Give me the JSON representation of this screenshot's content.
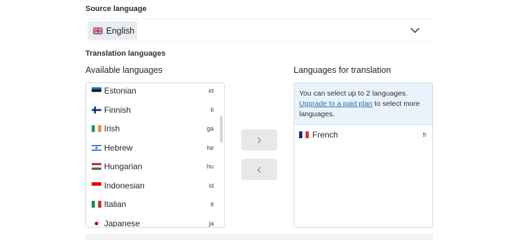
{
  "source": {
    "label": "Source language",
    "selected": "English",
    "selected_flag": "uk-flag-icon",
    "dropdown_icon": "chevron-down-icon"
  },
  "translation": {
    "label": "Translation languages",
    "available_heading": "Available languages",
    "target_heading": "Languages for translation",
    "available": [
      {
        "name": "Estonian",
        "code": "et",
        "flag": "estonia-flag-icon"
      },
      {
        "name": "Finnish",
        "code": "fi",
        "flag": "finland-flag-icon"
      },
      {
        "name": "Irish",
        "code": "ga",
        "flag": "ireland-flag-icon"
      },
      {
        "name": "Hebrew",
        "code": "he",
        "flag": "israel-flag-icon"
      },
      {
        "name": "Hungarian",
        "code": "hu",
        "flag": "hungary-flag-icon"
      },
      {
        "name": "Indonesian",
        "code": "id",
        "flag": "indonesia-flag-icon"
      },
      {
        "name": "Italian",
        "code": "it",
        "flag": "italy-flag-icon"
      },
      {
        "name": "Japanese",
        "code": "ja",
        "flag": "japan-flag-icon"
      }
    ],
    "info_text_1": "You can select up to 2 languages.",
    "info_link": "Upgrade to a paid plan",
    "info_text_2": " to select more languages.",
    "selected": [
      {
        "name": "French",
        "code": "fr",
        "flag": "france-flag-icon"
      }
    ],
    "add_icon": "chevron-right-icon",
    "remove_icon": "chevron-left-icon"
  },
  "colors": {
    "info_bg": "#eaf3fb",
    "link": "#2a6fa8",
    "button_bg": "#e6e8ea"
  }
}
